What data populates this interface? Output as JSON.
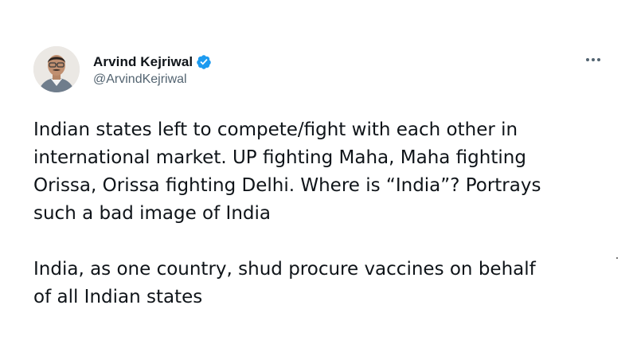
{
  "tweet": {
    "author": {
      "display_name": "Arvind Kejriwal",
      "handle": "@ArvindKejriwal",
      "verified": true,
      "avatar_icon": "profile-photo"
    },
    "more_icon": "more-options-icon",
    "text": {
      "paragraph_1": "Indian states left to compete/fight with each other in\ninternational market. UP fighting Maha, Maha fighting\nOrissa, Orissa fighting Delhi. Where is “India”? Portrays\nsuch a bad image of India",
      "paragraph_2": "India, as one country, shud procure vaccines on behalf\nof all Indian states"
    }
  },
  "colors": {
    "text_primary": "#0f1419",
    "text_secondary": "#536471",
    "verified_badge": "#1d9bf0",
    "background": "#ffffff"
  }
}
